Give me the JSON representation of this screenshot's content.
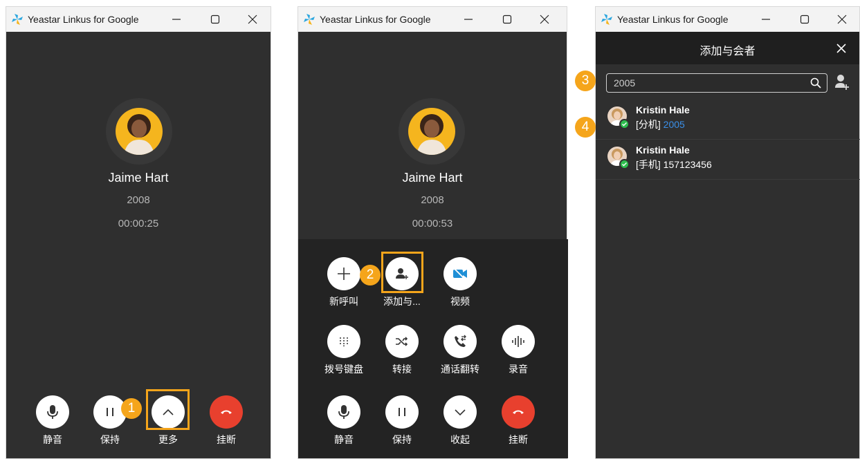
{
  "window_title": "Yeastar Linkus for Google",
  "icons": {
    "app": "yeastar-pinwheel-icon",
    "minimize": "minimize-icon",
    "maximize": "maximize-icon",
    "close": "close-icon",
    "search": "search-icon",
    "add_contact": "add-contact-icon"
  },
  "colors": {
    "accent": "#f5a51b",
    "hangup": "#e8402e",
    "link": "#3a8fe8",
    "online": "#2ebd4e"
  },
  "call1": {
    "name": "Jaime Hart",
    "ext": "2008",
    "timer": "00:00:25",
    "buttons": [
      {
        "icon": "microphone-icon",
        "label": "静音"
      },
      {
        "icon": "pause-icon",
        "label": "保持"
      },
      {
        "icon": "chevron-up-icon",
        "label": "更多"
      },
      {
        "icon": "hangup-icon",
        "label": "挂断"
      }
    ]
  },
  "call2": {
    "name": "Jaime Hart",
    "ext": "2008",
    "timer": "00:00:53",
    "buttons": [
      {
        "icon": "plus-icon",
        "label": "新呼叫"
      },
      {
        "icon": "add-participant-icon",
        "label": "添加与..."
      },
      {
        "icon": "video-off-icon",
        "label": "视频"
      },
      {
        "icon": "dialpad-icon",
        "label": "拨号键盘"
      },
      {
        "icon": "transfer-icon",
        "label": "转接"
      },
      {
        "icon": "call-flip-icon",
        "label": "通话翻转"
      },
      {
        "icon": "record-icon",
        "label": "录音"
      },
      {
        "icon": "microphone-icon",
        "label": "静音"
      },
      {
        "icon": "pause-icon",
        "label": "保持"
      },
      {
        "icon": "chevron-down-icon",
        "label": "收起"
      },
      {
        "icon": "hangup-icon",
        "label": "挂断"
      }
    ]
  },
  "participants": {
    "title": "添加与会者",
    "search_value": "2005",
    "results": [
      {
        "name": "Kristin Hale",
        "type": "[分机]",
        "number": "2005"
      },
      {
        "name": "Kristin Hale",
        "type": "[手机]",
        "number": "157123456"
      }
    ]
  },
  "steps": [
    "1",
    "2",
    "3",
    "4"
  ]
}
